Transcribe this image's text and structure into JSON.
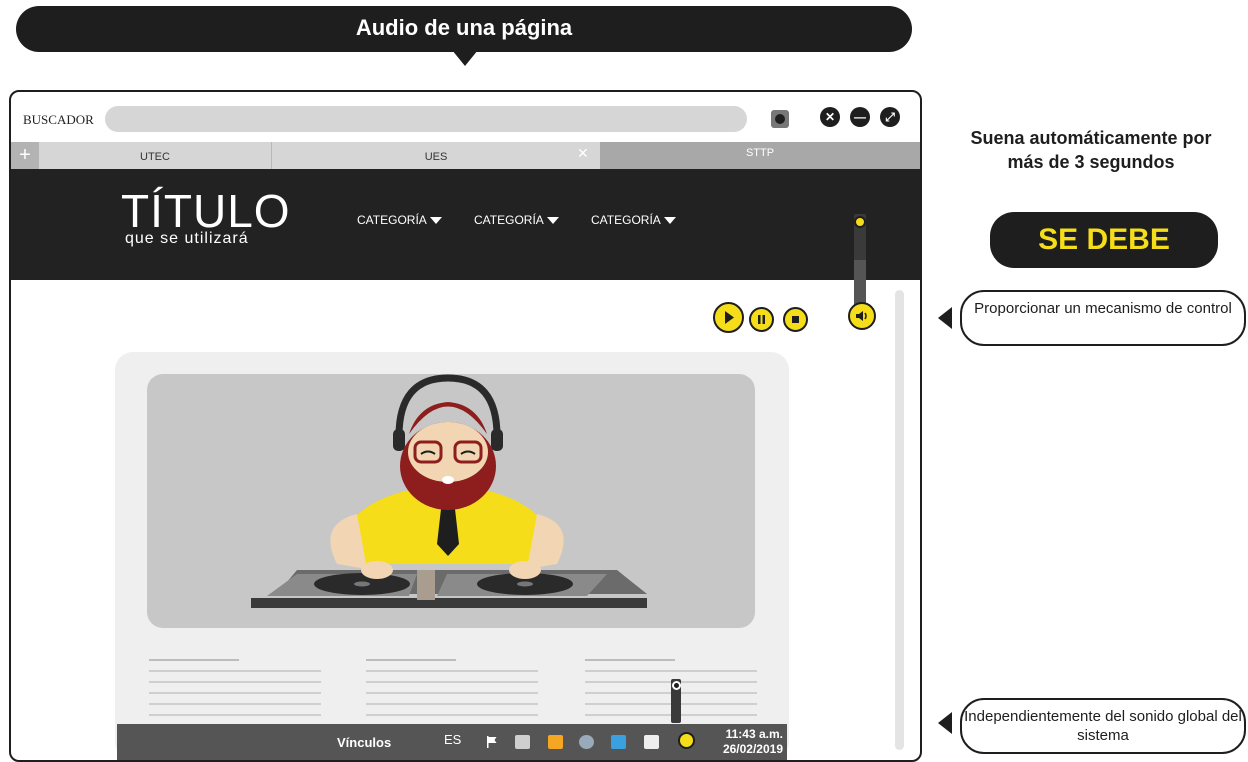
{
  "banner": {
    "title": "Audio de una página"
  },
  "browser": {
    "search_label": "BUSCADOR",
    "window_buttons": {
      "close": "✕",
      "minimize": "—",
      "maximize": "⤢"
    },
    "tabs": [
      {
        "label": "UTEC"
      },
      {
        "label": "UES"
      },
      {
        "label": "STTP"
      }
    ],
    "tab_add": "+",
    "tab_close": "✕"
  },
  "site": {
    "title": "TÍTULO",
    "subtitle": "que se utilizará",
    "nav": [
      {
        "label": "CATEGORÍA"
      },
      {
        "label": "CATEGORÍA"
      },
      {
        "label": "CATEGORÍA"
      }
    ]
  },
  "taskbar": {
    "label": "Vínculos",
    "lang": "ES",
    "time": "11:43 a.m.",
    "date": "26/02/2019"
  },
  "notes": {
    "title": "Suena automáticamente por más de 3 segundos",
    "badge": "SE DEBE",
    "callout_control": "Proporcionar un mecanismo de control",
    "callout_global": "Independientemente del sonido global del sistema"
  },
  "colors": {
    "accent": "#f5dd19",
    "dark": "#1e1e1e",
    "header": "#222222"
  },
  "icons": [
    "download-icon",
    "close-icon",
    "minimize-icon",
    "maximize-icon",
    "play-icon",
    "pause-icon",
    "stop-icon",
    "speaker-icon",
    "flag-icon",
    "network-icon",
    "outlook-icon",
    "chrome-icon",
    "monitor-icon"
  ]
}
